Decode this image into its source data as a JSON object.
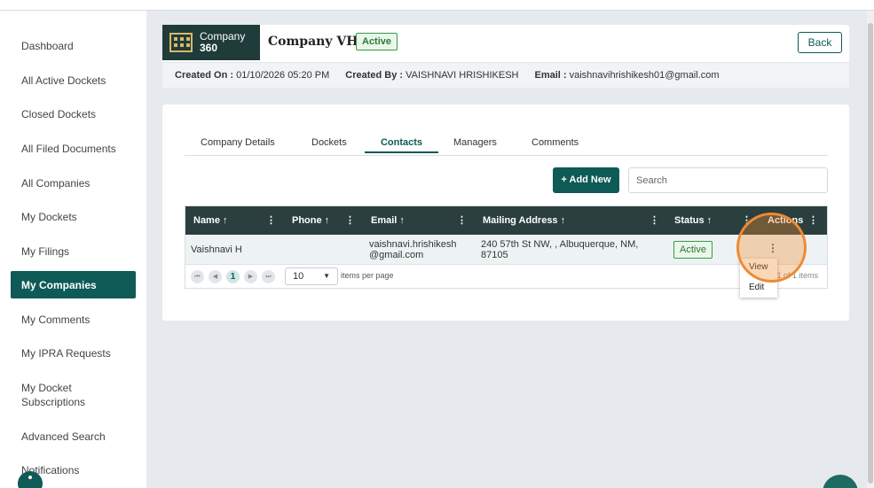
{
  "sidebar": {
    "items": [
      {
        "label": "Dashboard"
      },
      {
        "label": "All Active Dockets"
      },
      {
        "label": "Closed Dockets"
      },
      {
        "label": "All Filed Documents"
      },
      {
        "label": "All Companies"
      },
      {
        "label": "My Dockets"
      },
      {
        "label": "My Filings"
      },
      {
        "label": "My Companies",
        "active": true
      },
      {
        "label": "My Comments"
      },
      {
        "label": "My IPRA Requests"
      },
      {
        "label": "My Docket Subscriptions"
      },
      {
        "label": "Advanced Search"
      },
      {
        "label": "Notifications"
      }
    ]
  },
  "header": {
    "logo_line1": "Company",
    "logo_line2": "360",
    "company_name": "Company VH",
    "status": "Active",
    "back_label": "Back",
    "created_on_label": "Created On :",
    "created_on_value": "01/10/2026 05:20 PM",
    "created_by_label": "Created By :",
    "created_by_value": "VAISHNAVI HRISHIKESH",
    "email_label": "Email :",
    "email_value": "vaishnavihrishikesh01@gmail.com"
  },
  "tabs": [
    {
      "label": "Company Details"
    },
    {
      "label": "Dockets"
    },
    {
      "label": "Contacts",
      "active": true
    },
    {
      "label": "Managers"
    },
    {
      "label": "Comments"
    }
  ],
  "toolbar": {
    "add_label": "+ Add New",
    "search_placeholder": "Search"
  },
  "grid": {
    "columns": [
      {
        "label": "Name ↑"
      },
      {
        "label": "Phone ↑"
      },
      {
        "label": "Email ↑"
      },
      {
        "label": "Mailing Address ↑"
      },
      {
        "label": "Status ↑"
      },
      {
        "label": "Actions"
      }
    ],
    "rows": [
      {
        "name": "Vaishnavi H",
        "phone": "",
        "email_line1": "vaishnavi.hrishikesh",
        "email_line2": "@gmail.com",
        "address_line1": "240 57th St NW, , Albuquerque, NM,",
        "address_line2": "87105",
        "status": "Active",
        "actions": "⋮"
      }
    ],
    "pager": {
      "current_page": "1",
      "page_size": "10",
      "page_size_label": "items per page",
      "info": "1 - 1 of 1 items"
    }
  },
  "action_menu": {
    "items": [
      {
        "label": "View"
      },
      {
        "label": "Edit"
      }
    ]
  },
  "colors": {
    "brand": "#0e5a56",
    "grid_header": "#2a3f3e",
    "highlight": "#ee8a33",
    "active_status": "#3a9a48"
  }
}
